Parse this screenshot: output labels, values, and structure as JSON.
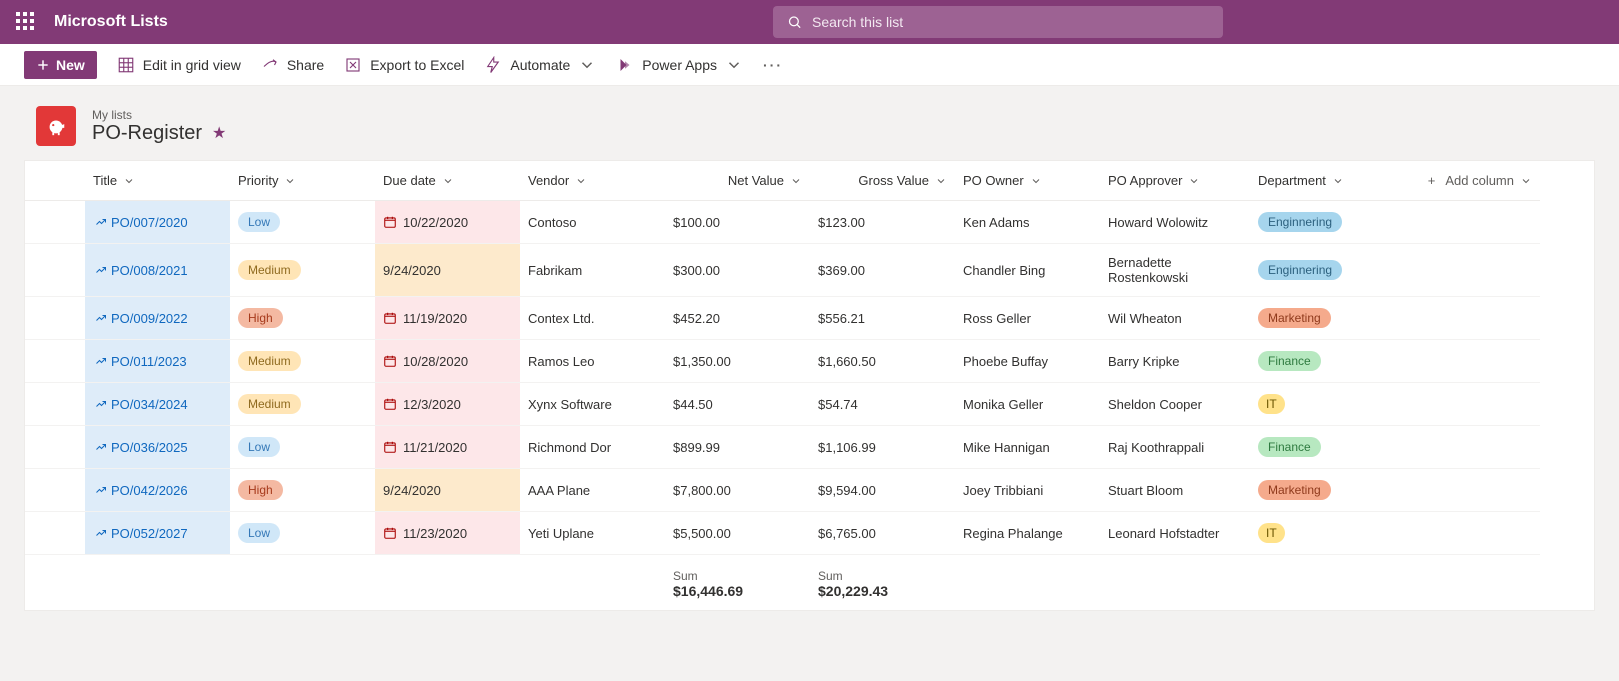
{
  "header": {
    "app_title": "Microsoft Lists",
    "search_placeholder": "Search this list"
  },
  "toolbar": {
    "new": "New",
    "grid_view": "Edit in grid view",
    "share": "Share",
    "export": "Export to Excel",
    "automate": "Automate",
    "powerapps": "Power Apps"
  },
  "list": {
    "breadcrumb": "My lists",
    "title": "PO-Register"
  },
  "columns": {
    "title": "Title",
    "priority": "Priority",
    "due": "Due date",
    "vendor": "Vendor",
    "net": "Net Value",
    "gross": "Gross Value",
    "owner": "PO Owner",
    "approver": "PO Approver",
    "dept": "Department",
    "add": "Add column"
  },
  "rows": [
    {
      "title": "PO/007/2020",
      "priority": "Low",
      "prClass": "low",
      "due": "10/22/2020",
      "dueClass": "late",
      "hasCal": true,
      "vendor": "Contoso",
      "net": "$100.00",
      "gross": "$123.00",
      "owner": "Ken Adams",
      "approver": "Howard Wolowitz",
      "dept": "Enginnering",
      "deptClass": "eng"
    },
    {
      "title": "PO/008/2021",
      "priority": "Medium",
      "prClass": "medium",
      "due": "9/24/2020",
      "dueClass": "warn",
      "hasCal": false,
      "vendor": "Fabrikam",
      "net": "$300.00",
      "gross": "$369.00",
      "owner": "Chandler Bing",
      "approver": "Bernadette Rostenkowski",
      "dept": "Enginnering",
      "deptClass": "eng"
    },
    {
      "title": "PO/009/2022",
      "priority": "High",
      "prClass": "high",
      "due": "11/19/2020",
      "dueClass": "late",
      "hasCal": true,
      "vendor": "Contex Ltd.",
      "net": "$452.20",
      "gross": "$556.21",
      "owner": "Ross Geller",
      "approver": "Wil Wheaton",
      "dept": "Marketing",
      "deptClass": "mkt"
    },
    {
      "title": "PO/011/2023",
      "priority": "Medium",
      "prClass": "medium",
      "due": "10/28/2020",
      "dueClass": "late",
      "hasCal": true,
      "vendor": "Ramos Leo",
      "net": "$1,350.00",
      "gross": "$1,660.50",
      "owner": "Phoebe Buffay",
      "approver": "Barry Kripke",
      "dept": "Finance",
      "deptClass": "fin"
    },
    {
      "title": "PO/034/2024",
      "priority": "Medium",
      "prClass": "medium",
      "due": "12/3/2020",
      "dueClass": "late",
      "hasCal": true,
      "vendor": "Xynx Software",
      "net": "$44.50",
      "gross": "$54.74",
      "owner": "Monika Geller",
      "approver": "Sheldon Cooper",
      "dept": "IT",
      "deptClass": "it"
    },
    {
      "title": "PO/036/2025",
      "priority": "Low",
      "prClass": "low",
      "due": "11/21/2020",
      "dueClass": "late",
      "hasCal": true,
      "vendor": "Richmond Dor",
      "net": "$899.99",
      "gross": "$1,106.99",
      "owner": "Mike Hannigan",
      "approver": "Raj Koothrappali",
      "dept": "Finance",
      "deptClass": "fin"
    },
    {
      "title": "PO/042/2026",
      "priority": "High",
      "prClass": "high",
      "due": "9/24/2020",
      "dueClass": "warn",
      "hasCal": false,
      "vendor": "AAA Plane",
      "net": "$7,800.00",
      "gross": "$9,594.00",
      "owner": "Joey Tribbiani",
      "approver": "Stuart Bloom",
      "dept": "Marketing",
      "deptClass": "mkt"
    },
    {
      "title": "PO/052/2027",
      "priority": "Low",
      "prClass": "low",
      "due": "11/23/2020",
      "dueClass": "late",
      "hasCal": true,
      "vendor": "Yeti Uplane",
      "net": "$5,500.00",
      "gross": "$6,765.00",
      "owner": "Regina Phalange",
      "approver": "Leonard Hofstadter",
      "dept": "IT",
      "deptClass": "it"
    }
  ],
  "sums": {
    "label": "Sum",
    "net": "$16,446.69",
    "gross": "$20,229.43"
  }
}
